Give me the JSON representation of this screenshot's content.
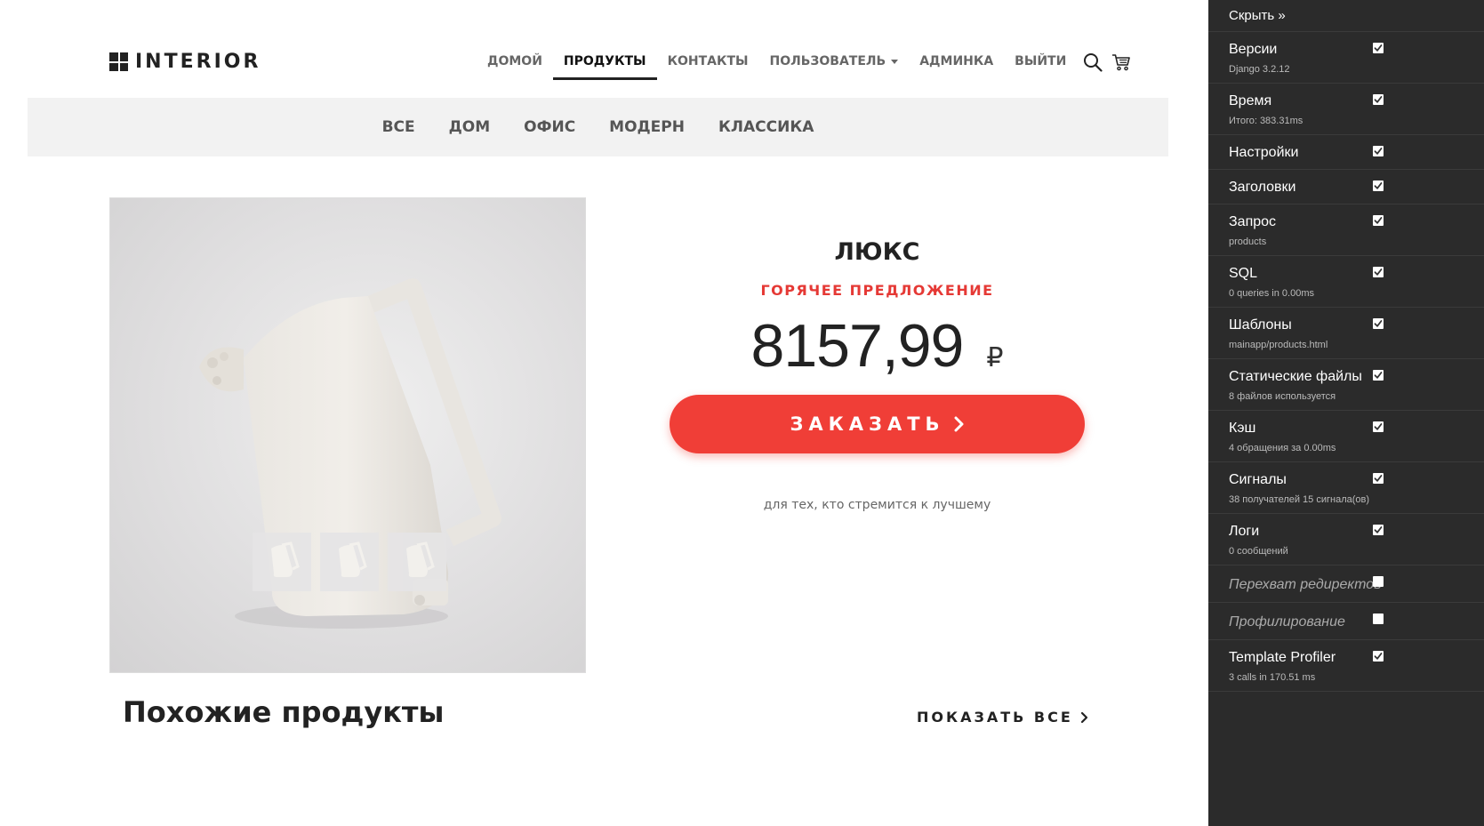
{
  "brand": {
    "name": "INTERIOR",
    "icon": "grid-logo-icon"
  },
  "nav": {
    "items": [
      {
        "label": "ДОМОЙ"
      },
      {
        "label": "ПРОДУКТЫ"
      },
      {
        "label": "КОНТАКТЫ"
      },
      {
        "label": "ПОЛЬЗОВАТЕЛЬ"
      },
      {
        "label": "АДМИНКА"
      },
      {
        "label": "ВЫЙТИ"
      }
    ],
    "active": "ПРОДУКТЫ",
    "icons": [
      "search-icon",
      "cart-icon"
    ]
  },
  "categories": [
    "ВСЕ",
    "ДОМ",
    "ОФИС",
    "МОДЕРН",
    "КЛАССИКА"
  ],
  "product": {
    "name": "ЛЮКС",
    "badge": "ГОРЯЧЕЕ ПРЕДЛОЖЕНИЕ",
    "price": "8157,99",
    "currency": "₽",
    "order_label": "ЗАКАЗАТЬ",
    "tagline": "для тех, кто стремится к лучшему",
    "thumbnails": 3
  },
  "related": {
    "title": "Похожие продукты",
    "show_all": "ПОКАЗАТЬ ВСЕ"
  },
  "debug_toolbar": {
    "hide": "Скрыть »",
    "panels": [
      {
        "title": "Версии",
        "sub": "Django 3.2.12",
        "checked": true
      },
      {
        "title": "Время",
        "sub": "Итого: 383.31ms",
        "checked": true
      },
      {
        "title": "Настройки",
        "sub": "",
        "checked": true
      },
      {
        "title": "Заголовки",
        "sub": "",
        "checked": true
      },
      {
        "title": "Запрос",
        "sub": "products",
        "checked": true
      },
      {
        "title": "SQL",
        "sub": "0 queries in 0.00ms",
        "checked": true
      },
      {
        "title": "Шаблоны",
        "sub": "mainapp/products.html",
        "checked": true
      },
      {
        "title": "Статические файлы",
        "sub": "8 файлов используется",
        "checked": true
      },
      {
        "title": "Кэш",
        "sub": "4 обращения за 0.00ms",
        "checked": true
      },
      {
        "title": "Сигналы",
        "sub": "38 получателей 15 сигнала(ов)",
        "checked": true
      },
      {
        "title": "Логи",
        "sub": "0 сообщений",
        "checked": true
      },
      {
        "title": "Перехват редиректов",
        "sub": "",
        "checked": false
      },
      {
        "title": "Профилирование",
        "sub": "",
        "checked": false
      },
      {
        "title": "Template Profiler",
        "sub": "3 calls in 170.51 ms",
        "checked": true
      }
    ]
  },
  "colors": {
    "accent": "#f03e37",
    "badge": "#e53935",
    "toolbar_bg": "#2b2b2b"
  }
}
